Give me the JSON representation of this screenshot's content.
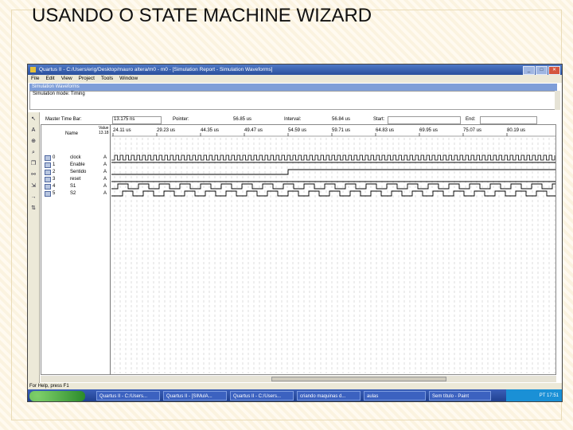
{
  "slide": {
    "title": "USANDO O STATE MACHINE WIZARD"
  },
  "window": {
    "title": "Quartus II - C:/Users/erig/Desktop/mauro altera/m0 - m0 - [Simulation Report - Simulation Waveforms]",
    "buttons": [
      "_",
      "□",
      "✕"
    ]
  },
  "menu": [
    "File",
    "Edit",
    "View",
    "Project",
    "Tools",
    "Window"
  ],
  "report": {
    "title": "Simulation Waveforms",
    "mode": "Simulation mode: Timing"
  },
  "timebar": {
    "master_label": "Master Time Bar:",
    "master_value": "13.175 ns",
    "pointer_label": "Pointer:",
    "pointer_value": "56.85 us",
    "interval_label": "Interval:",
    "interval_value": "56.84 us",
    "start_label": "Start:",
    "end_label": "End:"
  },
  "ruler": [
    "24.11 us",
    "29.23 us",
    "44.35 us",
    "49.47 us",
    "54.59 us",
    "59.71 us",
    "64.83 us",
    "69.95 us",
    "75.07 us",
    "80.19 us"
  ],
  "columns": {
    "name": "Name",
    "value": "Value 13.18"
  },
  "signals": [
    {
      "idx": "0",
      "name": "clock",
      "value": "A"
    },
    {
      "idx": "1",
      "name": "Enable",
      "value": "A"
    },
    {
      "idx": "2",
      "name": "Sentido",
      "value": "A"
    },
    {
      "idx": "3",
      "name": "reset",
      "value": "A"
    },
    {
      "idx": "4",
      "name": "S1",
      "value": "A"
    },
    {
      "idx": "5",
      "name": "S2",
      "value": "A"
    }
  ],
  "toolbar_icons": [
    "pointer-icon",
    "text-icon",
    "zoom-icon",
    "search-icon",
    "copy-icon",
    "binoculars-icon",
    "snap-icon",
    "arrow-icon",
    "sort-icon"
  ],
  "status": "For Help, press F1",
  "taskbar": {
    "tasks": [
      "Quartus II - C:/Users...",
      "Quartus II - [SIMulA...",
      "Quartus II - C:/Users...",
      "criando maquinas d...",
      "aulas",
      "Sem título - Paint"
    ],
    "tray_text": "PT",
    "clock": "17:51"
  },
  "colors": {
    "title_bar": "#2a4f9d",
    "taskbar": "#1d3d8c",
    "wave": "#000000"
  }
}
